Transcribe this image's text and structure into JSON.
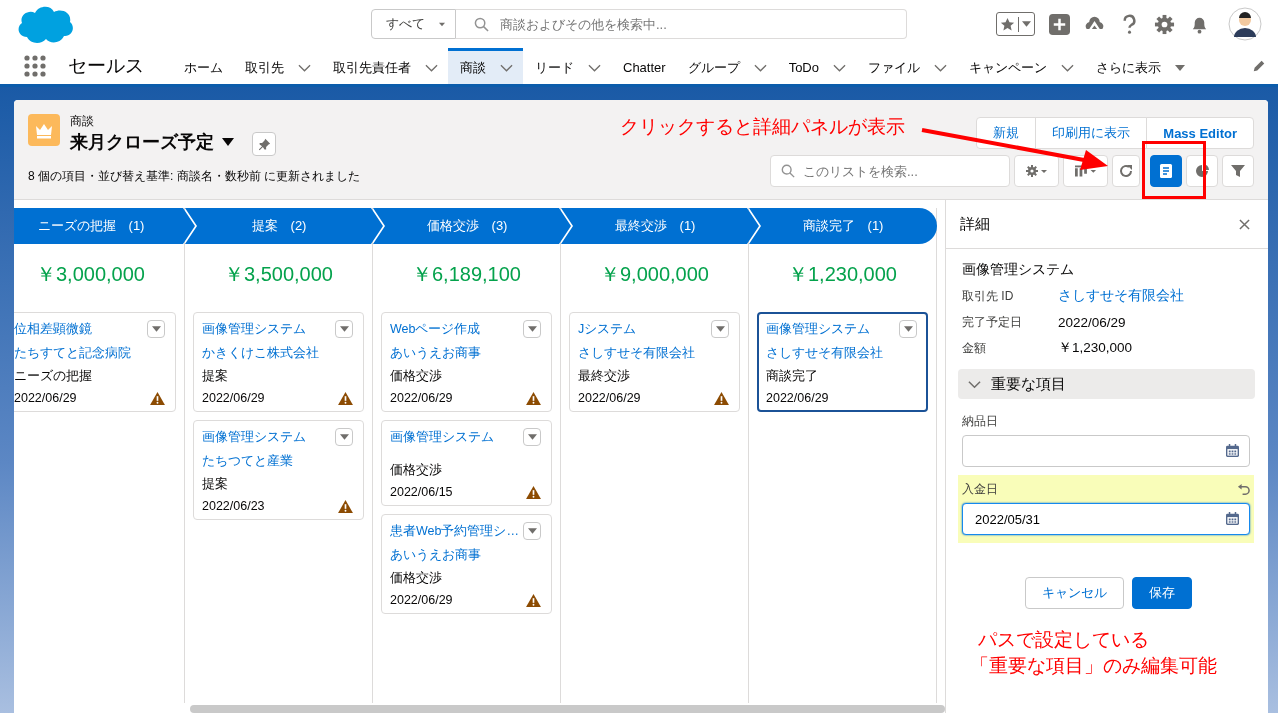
{
  "header": {
    "search_scope": "すべて",
    "search_placeholder": "商談およびその他を検索中..."
  },
  "nav": {
    "app_name": "セールス",
    "tabs": [
      {
        "label": "ホーム",
        "kind": "plain",
        "selected": false
      },
      {
        "label": "取引先",
        "kind": "dropdown",
        "selected": false
      },
      {
        "label": "取引先責任者",
        "kind": "dropdown",
        "selected": false
      },
      {
        "label": "商談",
        "kind": "dropdown",
        "selected": true
      },
      {
        "label": "リード",
        "kind": "dropdown",
        "selected": false
      },
      {
        "label": "Chatter",
        "kind": "plain",
        "selected": false
      },
      {
        "label": "グループ",
        "kind": "dropdown",
        "selected": false
      },
      {
        "label": "ToDo",
        "kind": "dropdown",
        "selected": false
      },
      {
        "label": "ファイル",
        "kind": "dropdown",
        "selected": false
      },
      {
        "label": "キャンペーン",
        "kind": "dropdown",
        "selected": false
      },
      {
        "label": "さらに表示",
        "kind": "more",
        "selected": false
      }
    ]
  },
  "list_header": {
    "object_label": "商談",
    "title": "来月クローズ予定",
    "status": "8 個の項目・並び替え基準: 商談名・数秒前 に更新されました",
    "buttons": [
      "新規",
      "印刷用に表示",
      "Mass Editor"
    ],
    "search_placeholder": "このリストを検索...",
    "tools": [
      {
        "kind": "settings",
        "selected": false
      },
      {
        "kind": "display",
        "selected": false
      },
      {
        "kind": "refresh",
        "selected": false
      },
      {
        "kind": "detail",
        "selected": true
      },
      {
        "kind": "chart",
        "selected": false
      },
      {
        "kind": "filter",
        "selected": false
      }
    ]
  },
  "stages": [
    {
      "label": "ニーズの把握",
      "count": "(1)",
      "total": "￥3,000,000",
      "cards": [
        {
          "name": "位相差顕微鏡",
          "account": "たちすてと記念病院",
          "stage": "ニーズの把握",
          "date": "2022/06/29",
          "warning": true,
          "selected": false
        }
      ]
    },
    {
      "label": "提案",
      "count": "(2)",
      "total": "￥3,500,000",
      "cards": [
        {
          "name": "画像管理システム",
          "account": "かきくけこ株式会社",
          "stage": "提案",
          "date": "2022/06/29",
          "warning": true,
          "selected": false
        },
        {
          "name": "画像管理システム",
          "account": "たちつてと産業",
          "stage": "提案",
          "date": "2022/06/23",
          "warning": true,
          "selected": false
        }
      ]
    },
    {
      "label": "価格交渉",
      "count": "(3)",
      "total": "￥6,189,100",
      "cards": [
        {
          "name": "Webページ作成",
          "account": "あいうえお商事",
          "stage": "価格交渉",
          "date": "2022/06/29",
          "warning": true,
          "selected": false
        },
        {
          "name": "画像管理システム",
          "stage": "価格交渉",
          "date": "2022/06/15",
          "warning": true,
          "selected": false
        },
        {
          "name": "患者Web予約管理シ…",
          "account": "あいうえお商事",
          "stage": "価格交渉",
          "date": "2022/06/29",
          "warning": true,
          "selected": false
        }
      ]
    },
    {
      "label": "最終交渉",
      "count": "(1)",
      "total": "￥9,000,000",
      "cards": [
        {
          "name": "Jシステム",
          "account": "さしすせそ有限会社",
          "stage": "最終交渉",
          "date": "2022/06/29",
          "warning": true,
          "selected": false
        }
      ]
    },
    {
      "label": "商談完了",
      "count": "(1)",
      "total": "￥1,230,000",
      "cards": [
        {
          "name": "画像管理システム",
          "account": "さしすせそ有限会社",
          "stage": "商談完了",
          "date": "2022/06/29",
          "warning": false,
          "selected": true
        }
      ]
    }
  ],
  "detail": {
    "title": "詳細",
    "record_name": "画像管理システム",
    "fields": [
      {
        "label": "取引先 ID",
        "value": "さしすせそ有限会社",
        "kind": "link"
      },
      {
        "label": "完了予定日",
        "value": "2022/06/29",
        "kind": "text"
      },
      {
        "label": "金額",
        "value": "￥1,230,000",
        "kind": "text"
      }
    ],
    "section": {
      "title": "重要な項目",
      "expanded": true
    },
    "inputs": [
      {
        "label": "納品日",
        "changed": false
      },
      {
        "label": "入金日",
        "value": "2022/05/31",
        "changed": true
      }
    ],
    "buttons": [
      "キャンセル",
      "保存"
    ]
  },
  "annotations": [
    {
      "text": "クリックすると詳細パネルが表示"
    },
    {
      "text": "パスで設定している"
    },
    {
      "text": "「重要な項目」のみ編集可能"
    }
  ]
}
